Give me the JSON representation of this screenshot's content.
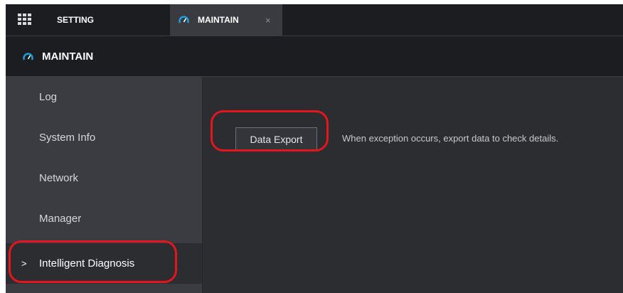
{
  "tabs": [
    {
      "label": "SETTING",
      "icon": "grid-icon"
    },
    {
      "label": "MAINTAIN",
      "icon": "gauge-icon",
      "close_glyph": "×"
    }
  ],
  "header": {
    "title": "MAINTAIN",
    "icon": "gauge-icon"
  },
  "sidebar": {
    "items": [
      {
        "label": "Log"
      },
      {
        "label": "System Info"
      },
      {
        "label": "Network"
      },
      {
        "label": "Manager"
      },
      {
        "label": "Intelligent Diagnosis",
        "active": true,
        "marker": ">"
      }
    ]
  },
  "main": {
    "export_button_label": "Data Export",
    "description": "When exception occurs, export data to check details."
  },
  "colors": {
    "accent": "#1fa3e0",
    "annotation": "#e3161d",
    "panel": "#2c2d31",
    "sidebar": "#3b3c41"
  }
}
